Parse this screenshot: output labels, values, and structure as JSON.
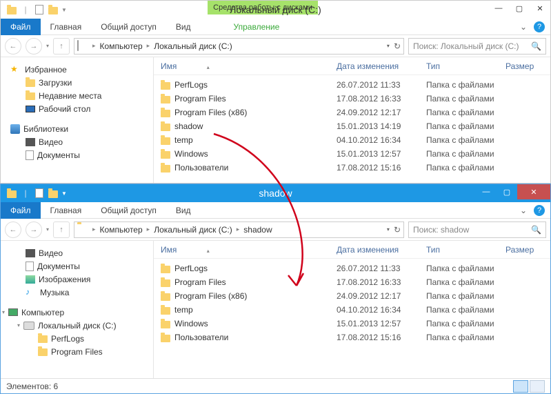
{
  "window1": {
    "titleContext": "Средства работы с дисками",
    "title": "Локальный диск (C:)",
    "ribbon": {
      "file": "Файл",
      "home": "Главная",
      "share": "Общий доступ",
      "view": "Вид",
      "manage": "Управление"
    },
    "breadcrumbs": [
      "Компьютер",
      "Локальный диск (C:)"
    ],
    "searchPlaceholder": "Поиск: Локальный диск (C:)",
    "columns": {
      "name": "Имя",
      "date": "Дата изменения",
      "type": "Тип",
      "size": "Размер"
    },
    "sidebar": {
      "favorites": "Избранное",
      "downloads": "Загрузки",
      "recent": "Недавние места",
      "desktop": "Рабочий стол",
      "libraries": "Библиотеки",
      "video": "Видео",
      "documents": "Документы"
    },
    "rows": [
      {
        "name": "PerfLogs",
        "date": "26.07.2012 11:33",
        "type": "Папка с файлами"
      },
      {
        "name": "Program Files",
        "date": "17.08.2012 16:33",
        "type": "Папка с файлами"
      },
      {
        "name": "Program Files (x86)",
        "date": "24.09.2012 12:17",
        "type": "Папка с файлами"
      },
      {
        "name": "shadow",
        "date": "15.01.2013 14:19",
        "type": "Папка с файлами"
      },
      {
        "name": "temp",
        "date": "04.10.2012 16:34",
        "type": "Папка с файлами"
      },
      {
        "name": "Windows",
        "date": "15.01.2013 12:57",
        "type": "Папка с файлами"
      },
      {
        "name": "Пользователи",
        "date": "17.08.2012 15:16",
        "type": "Папка с файлами"
      }
    ]
  },
  "window2": {
    "title": "shadow",
    "ribbon": {
      "file": "Файл",
      "home": "Главная",
      "share": "Общий доступ",
      "view": "Вид"
    },
    "breadcrumbs": [
      "Компьютер",
      "Локальный диск (C:)",
      "shadow"
    ],
    "searchPlaceholder": "Поиск: shadow",
    "columns": {
      "name": "Имя",
      "date": "Дата изменения",
      "type": "Тип",
      "size": "Размер"
    },
    "sidebar": {
      "video": "Видео",
      "documents": "Документы",
      "pictures": "Изображения",
      "music": "Музыка",
      "computer": "Компьютер",
      "localdisk": "Локальный диск (C:)",
      "perflogs": "PerfLogs",
      "programfiles": "Program Files"
    },
    "rows": [
      {
        "name": "PerfLogs",
        "date": "26.07.2012 11:33",
        "type": "Папка с файлами"
      },
      {
        "name": "Program Files",
        "date": "17.08.2012 16:33",
        "type": "Папка с файлами"
      },
      {
        "name": "Program Files (x86)",
        "date": "24.09.2012 12:17",
        "type": "Папка с файлами"
      },
      {
        "name": "temp",
        "date": "04.10.2012 16:34",
        "type": "Папка с файлами"
      },
      {
        "name": "Windows",
        "date": "15.01.2013 12:57",
        "type": "Папка с файлами"
      },
      {
        "name": "Пользователи",
        "date": "17.08.2012 15:16",
        "type": "Папка с файлами"
      }
    ],
    "status": "Элементов: 6"
  }
}
